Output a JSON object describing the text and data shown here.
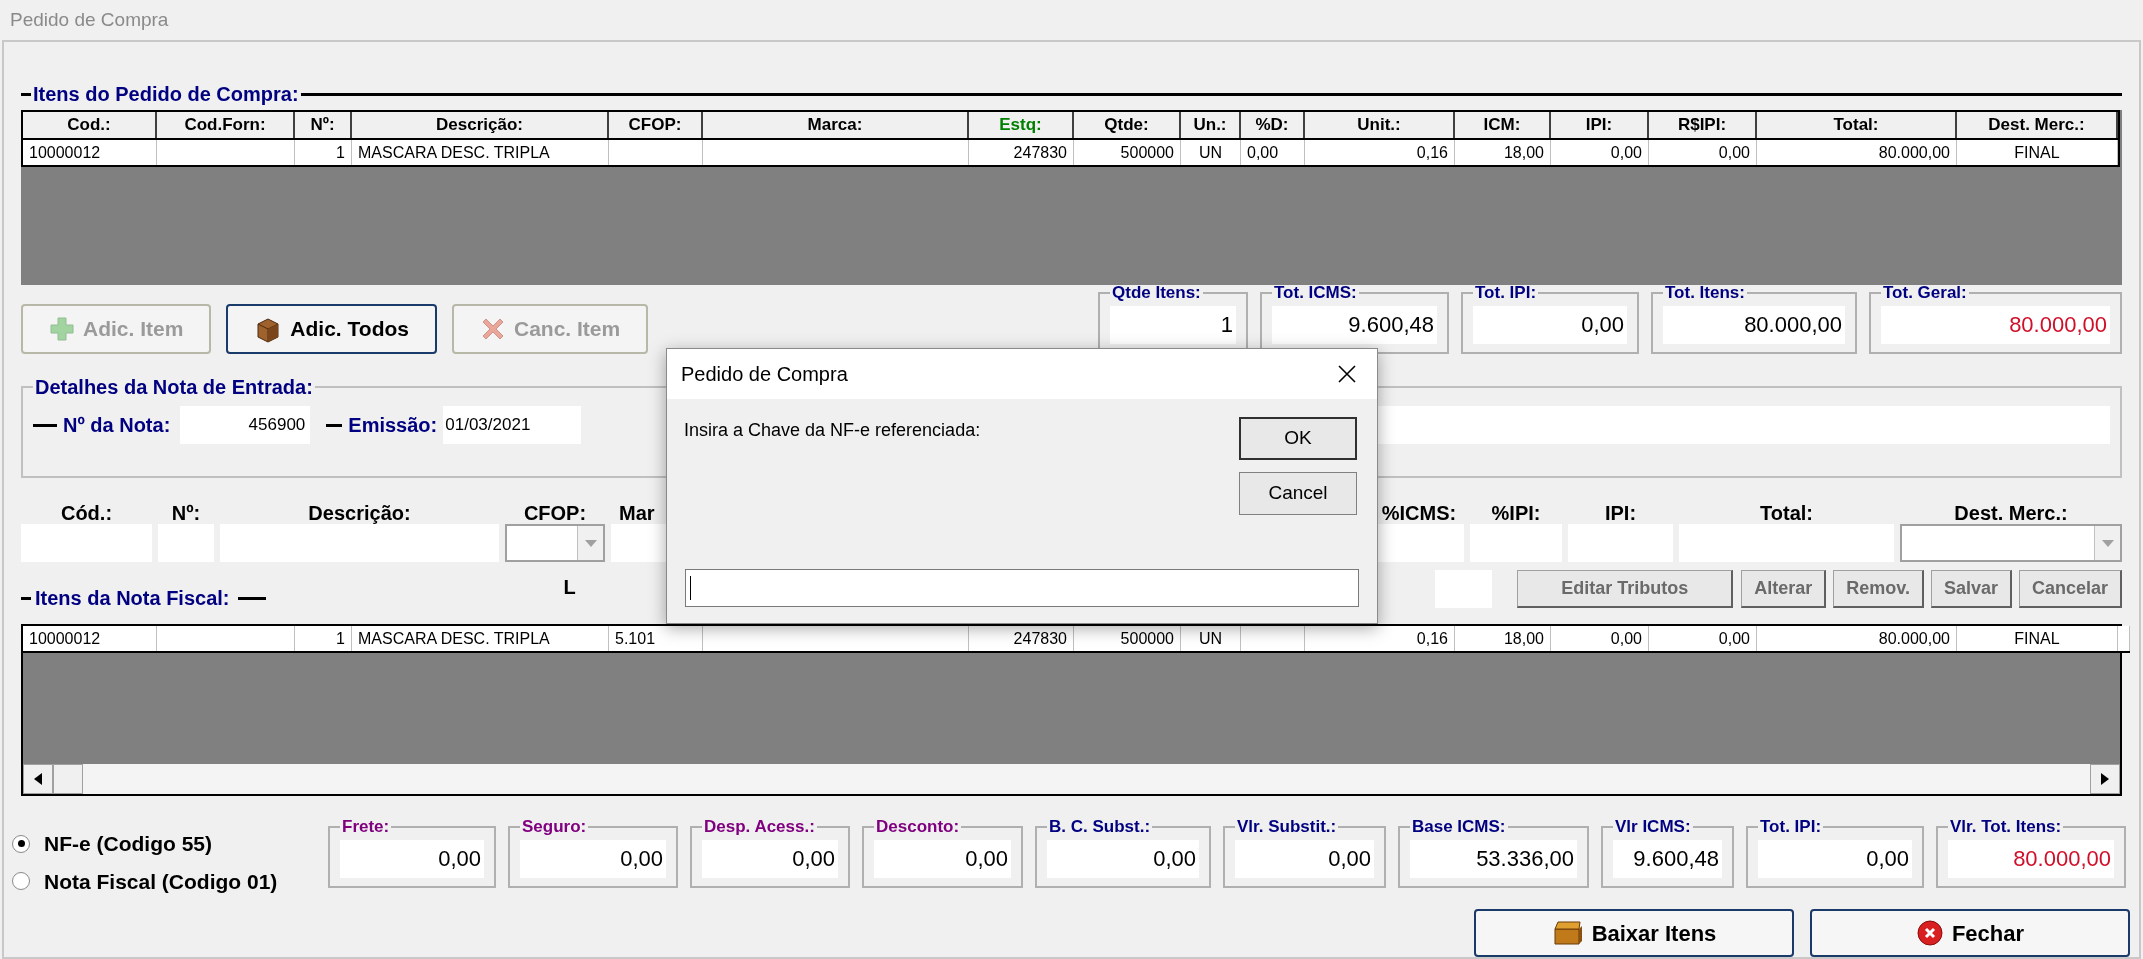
{
  "window": {
    "title": "Pedido de Compra"
  },
  "order_items": {
    "title": "Itens do Pedido de Compra:",
    "columns": [
      {
        "label": "Cod.:",
        "color": "#000000"
      },
      {
        "label": "Cod.Forn:",
        "color": "#000000"
      },
      {
        "label": "Nº:",
        "color": "#000000"
      },
      {
        "label": "Descrição:",
        "color": "#000000"
      },
      {
        "label": "CFOP:",
        "color": "#000000"
      },
      {
        "label": "Marca:",
        "color": "#000000"
      },
      {
        "label": "Estq:",
        "color": "#008000"
      },
      {
        "label": "Qtde:",
        "color": "#000000"
      },
      {
        "label": "Un.:",
        "color": "#000000"
      },
      {
        "label": "%D:",
        "color": "#000000"
      },
      {
        "label": "Unit.:",
        "color": "#000000"
      },
      {
        "label": "ICM:",
        "color": "#000000"
      },
      {
        "label": "IPI:",
        "color": "#000000"
      },
      {
        "label": "R$IPI:",
        "color": "#000000"
      },
      {
        "label": "Total:",
        "color": "#000000"
      },
      {
        "label": "Dest. Merc.:",
        "color": "#000000"
      }
    ],
    "rows": [
      {
        "cells": [
          "10000012",
          "",
          "1",
          "MASCARA DESC. TRIPLA",
          "",
          "",
          "247830",
          "500000",
          "UN",
          "0,00",
          "0,16",
          "18,00",
          "0,00",
          "0,00",
          "80.000,00",
          "FINAL"
        ]
      }
    ]
  },
  "action_buttons": [
    {
      "label": "Adic. Item",
      "kind": "plus",
      "disabled": true
    },
    {
      "label": "Adic. Todos",
      "kind": "box",
      "disabled": false
    },
    {
      "label": "Canc. Item",
      "kind": "cross",
      "disabled": true
    }
  ],
  "totals": [
    {
      "label": "Qtde Itens:",
      "value": "1",
      "highlight": false
    },
    {
      "label": "Tot. ICMS:",
      "value": "9.600,48",
      "highlight": false
    },
    {
      "label": "Tot. IPI:",
      "value": "0,00",
      "highlight": false
    },
    {
      "label": "Tot. Itens:",
      "value": "80.000,00",
      "highlight": false
    },
    {
      "label": "Tot. Geral:",
      "value": "80.000,00",
      "highlight": true
    }
  ],
  "invoice_details": {
    "title": "Detalhes da Nota de Entrada:",
    "number_label": "Nº da Nota:",
    "number": "456900",
    "issue_label": "Emissão:",
    "issue_date": "01/03/2021"
  },
  "item_fields": [
    {
      "label": "Cód.:",
      "kind": "text"
    },
    {
      "label": "Nº:",
      "kind": "text"
    },
    {
      "label": "Descrição:",
      "kind": "text"
    },
    {
      "label": "CFOP:",
      "kind": "select"
    },
    {
      "label": "Mar",
      "kind": "partial"
    },
    {
      "label": "%ICMS:",
      "kind": "text"
    },
    {
      "label": "%IPI:",
      "kind": "text"
    },
    {
      "label": "IPI:",
      "kind": "text"
    },
    {
      "label": "Total:",
      "kind": "text"
    },
    {
      "label": "Dest. Merc.:",
      "kind": "select"
    }
  ],
  "invoice_items": {
    "title": "Itens da Nota Fiscal:",
    "partial_label": "L",
    "buttons": [
      {
        "label": "Editar Tributos",
        "disabled": true
      },
      {
        "label": "Alterar",
        "disabled": true
      },
      {
        "label": "Remov.",
        "disabled": true
      },
      {
        "label": "Salvar",
        "disabled": true
      },
      {
        "label": "Cancelar",
        "disabled": true
      }
    ],
    "rows": [
      {
        "cells": [
          "10000012",
          "",
          "1",
          "MASCARA DESC. TRIPLA",
          "5.101",
          "",
          "247830",
          "500000",
          "UN",
          "",
          "0,16",
          "18,00",
          "0,00",
          "0,00",
          "80.000,00",
          "FINAL"
        ]
      }
    ]
  },
  "document_type": [
    {
      "label": "NF-e (Codigo 55)",
      "selected": true
    },
    {
      "label": "Nota Fiscal (Codigo 01)",
      "selected": false
    }
  ],
  "summary": [
    {
      "label": "Frete:",
      "value": "0,00",
      "color": "#800080",
      "highlight": false
    },
    {
      "label": "Seguro:",
      "value": "0,00",
      "color": "#800080",
      "highlight": false
    },
    {
      "label": "Desp. Acess.:",
      "value": "0,00",
      "color": "#800080",
      "highlight": false
    },
    {
      "label": "Desconto:",
      "value": "0,00",
      "color": "#800080",
      "highlight": false
    },
    {
      "label": "B. C. Subst.:",
      "value": "0,00",
      "color": "#000080",
      "highlight": false
    },
    {
      "label": "Vlr. Substit.:",
      "value": "0,00",
      "color": "#000080",
      "highlight": false
    },
    {
      "label": "Base ICMS:",
      "value": "53.336,00",
      "color": "#000080",
      "highlight": false
    },
    {
      "label": "Vlr ICMS:",
      "value": "9.600,48",
      "color": "#000080",
      "highlight": false
    },
    {
      "label": "Tot. IPI:",
      "value": "0,00",
      "color": "#000080",
      "highlight": false
    },
    {
      "label": "Vlr. Tot. Itens:",
      "value": "80.000,00",
      "color": "#000080",
      "highlight": true
    }
  ],
  "footer_buttons": [
    {
      "label": "Baixar Itens",
      "kind": "download"
    },
    {
      "label": "Fechar",
      "kind": "close"
    }
  ],
  "dialog": {
    "title": "Pedido de Compra",
    "message": "Insira a Chave da NF-e referenciada:",
    "buttons": [
      {
        "label": "OK",
        "default": true
      },
      {
        "label": "Cancel",
        "default": false
      }
    ]
  }
}
